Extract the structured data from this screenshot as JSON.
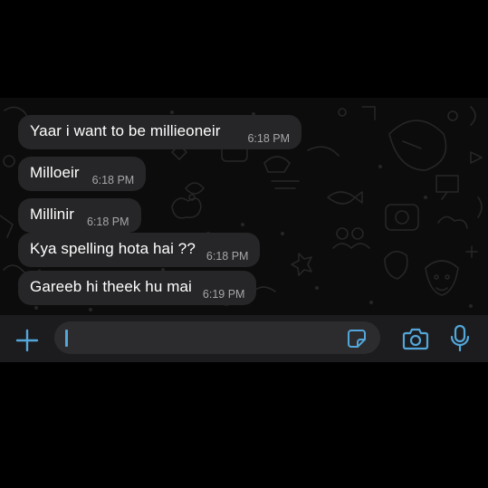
{
  "messages": [
    {
      "text": "Yaar i want to be millieoneir",
      "time": "6:18 PM"
    },
    {
      "text": "Milloeir",
      "time": "6:18 PM"
    },
    {
      "text": "Millinir",
      "time": "6:18 PM"
    },
    {
      "text": "Kya spelling hota hai ??",
      "time": "6:18 PM"
    },
    {
      "text": "Gareeb hi theek hu mai",
      "time": "6:19 PM"
    }
  ],
  "composer": {
    "icons": [
      "plus-icon",
      "sticker-icon",
      "camera-icon",
      "microphone-icon"
    ],
    "accent_color": "#53a6d9"
  },
  "colors": {
    "background": "#000000",
    "chat_background": "#0c0c0c",
    "bubble": "#262628",
    "timestamp": "#a6a6a9",
    "input_bar": "#1c1c1e"
  }
}
